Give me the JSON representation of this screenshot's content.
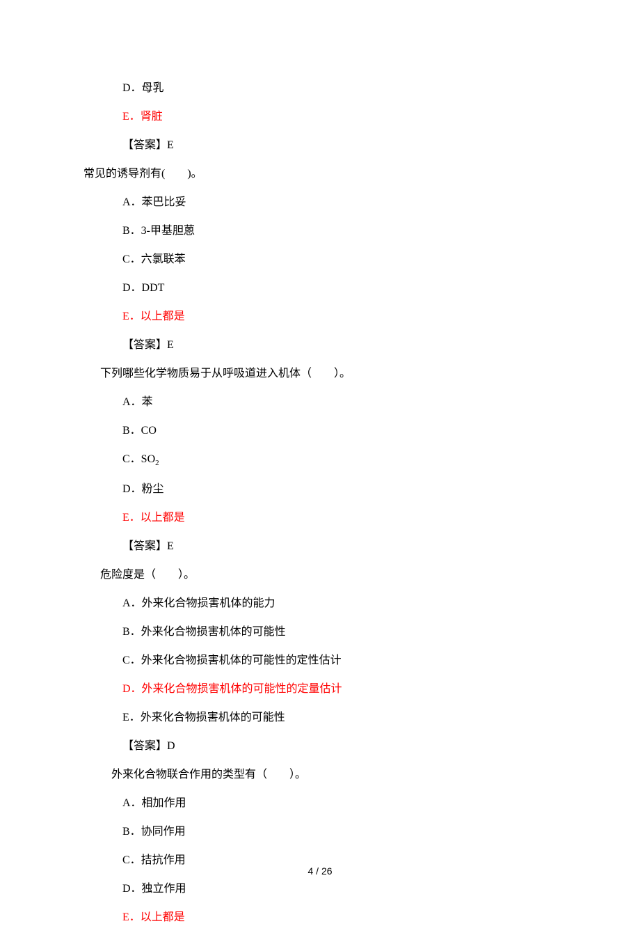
{
  "partial_options": {
    "d": "D．母乳",
    "e": "E．肾脏",
    "answer": "【答案】E"
  },
  "q1": {
    "stem": "常见的诱导剂有(　　)。",
    "a": "A．苯巴比妥",
    "b": "B．3-甲基胆蒽",
    "c": "C．六氯联苯",
    "d": "D．DDT",
    "e": "E．以上都是",
    "answer": "【答案】E"
  },
  "q2": {
    "stem": "下列哪些化学物质易于从呼吸道进入机体（　　）。",
    "a": "A．苯",
    "b": "B．CO",
    "c_prefix": "C．SO",
    "c_sub": "2",
    "d": "D．粉尘",
    "e": "E．以上都是",
    "answer": "【答案】E"
  },
  "q3": {
    "stem": "危险度是（　　）。",
    "a": "A．外来化合物损害机体的能力",
    "b": "B．外来化合物损害机体的可能性",
    "c": "C．外来化合物损害机体的可能性的定性估计",
    "d": "D．外来化合物损害机体的可能性的定量估计",
    "e": "E．外来化合物损害机体的可能性",
    "answer": "【答案】D"
  },
  "q4": {
    "stem": "外来化合物联合作用的类型有（　　）。",
    "a": "A．相加作用",
    "b": "B．协同作用",
    "c": "C．拮抗作用",
    "d": "D．独立作用",
    "e": "E．以上都是"
  },
  "footer": "4 / 26"
}
